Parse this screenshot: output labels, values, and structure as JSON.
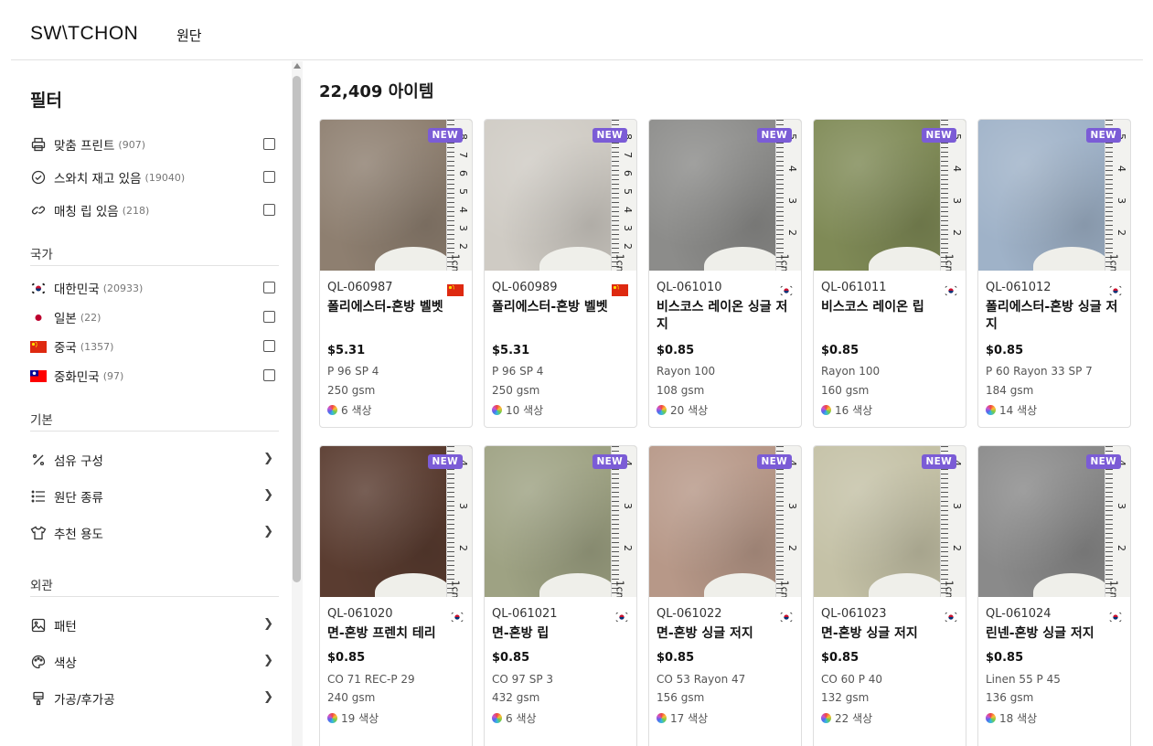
{
  "header": {
    "logo": "SW\\TCHON",
    "nav": "원단"
  },
  "sidebar": {
    "title": "필터",
    "toggles": [
      {
        "icon": "printer-icon",
        "label": "맞춤 프린트",
        "count": "(907)"
      },
      {
        "icon": "check-circle-icon",
        "label": "스와치 재고 있음",
        "count": "(19040)"
      },
      {
        "icon": "link-icon",
        "label": "매칭 립 있음",
        "count": "(218)"
      }
    ],
    "country_section": "국가",
    "countries": [
      {
        "flag": "kr",
        "label": "대한민국",
        "count": "(20933)"
      },
      {
        "flag": "jp",
        "label": "일본",
        "count": "(22)"
      },
      {
        "flag": "cn",
        "label": "중국",
        "count": "(1357)"
      },
      {
        "flag": "tw",
        "label": "중화민국",
        "count": "(97)"
      }
    ],
    "basic_section": "기본",
    "basic_items": [
      {
        "icon": "percent-icon",
        "label": "섬유 구성"
      },
      {
        "icon": "list-icon",
        "label": "원단 종류"
      },
      {
        "icon": "shirt-icon",
        "label": "추천 용도"
      }
    ],
    "appearance_section": "외관",
    "appearance_items": [
      {
        "icon": "image-icon",
        "label": "패턴"
      },
      {
        "icon": "palette-icon",
        "label": "색상"
      },
      {
        "icon": "brush-icon",
        "label": "가공/후가공"
      }
    ]
  },
  "main": {
    "item_count": "22,409 아이템",
    "badge": "NEW",
    "products": [
      {
        "code": "QL-060987",
        "flag": "cn",
        "name": "폴리에스터-혼방 벨벳",
        "price": "$5.31",
        "composition": "P 96 SP 4",
        "gsm": "250 gsm",
        "colors": "6 색상",
        "swatch": "#8e7f70",
        "ruler": [
          "8",
          "7",
          "6",
          "5",
          "4",
          "3",
          "2",
          "1cm"
        ]
      },
      {
        "code": "QL-060989",
        "flag": "cn",
        "name": "폴리에스터-혼방 벨벳",
        "price": "$5.31",
        "composition": "P 96 SP 4",
        "gsm": "250 gsm",
        "colors": "10 색상",
        "swatch": "#cfcbc4",
        "ruler": [
          "8",
          "7",
          "6",
          "5",
          "4",
          "3",
          "2",
          "1cm"
        ]
      },
      {
        "code": "QL-061010",
        "flag": "kr",
        "name": "비스코스 레이온 싱글 저지",
        "price": "$0.85",
        "composition": "Rayon 100",
        "gsm": "108 gsm",
        "colors": "20 색상",
        "swatch": "#8c8c8a",
        "ruler": [
          "5",
          "4",
          "3",
          "2",
          "1cm"
        ]
      },
      {
        "code": "QL-061011",
        "flag": "kr",
        "name": "비스코스 레이온 립",
        "price": "$0.85",
        "composition": "Rayon 100",
        "gsm": "160 gsm",
        "colors": "16 색상",
        "swatch": "#7f8a56",
        "ruler": [
          "5",
          "4",
          "3",
          "2",
          "1cm"
        ]
      },
      {
        "code": "QL-061012",
        "flag": "kr",
        "name": "폴리에스터-혼방 싱글 저지",
        "price": "$0.85",
        "composition": "P 60 Rayon 33 SP 7",
        "gsm": "184 gsm",
        "colors": "14 색상",
        "swatch": "#9fb2c8",
        "ruler": [
          "5",
          "4",
          "3",
          "2",
          "1cm"
        ]
      },
      {
        "code": "QL-061020",
        "flag": "kr",
        "name": "면-혼방 프렌치 테리",
        "price": "$0.85",
        "composition": "CO 71 REC-P 29",
        "gsm": "240 gsm",
        "colors": "19 색상",
        "swatch": "#5a3c30",
        "ruler": [
          "4",
          "3",
          "2",
          "1cm"
        ]
      },
      {
        "code": "QL-061021",
        "flag": "kr",
        "name": "면-혼방 립",
        "price": "$0.85",
        "composition": "CO 97 SP 3",
        "gsm": "432 gsm",
        "colors": "6 색상",
        "swatch": "#9ea283",
        "ruler": [
          "4",
          "3",
          "2",
          "1cm"
        ]
      },
      {
        "code": "QL-061022",
        "flag": "kr",
        "name": "면-혼방 싱글 저지",
        "price": "$0.85",
        "composition": "CO 53 Rayon 47",
        "gsm": "156 gsm",
        "colors": "17 색상",
        "swatch": "#b79888",
        "ruler": [
          "4",
          "3",
          "2",
          "1cm"
        ]
      },
      {
        "code": "QL-061023",
        "flag": "kr",
        "name": "면-혼방 싱글 저지",
        "price": "$0.85",
        "composition": "CO 60 P 40",
        "gsm": "132 gsm",
        "colors": "22 색상",
        "swatch": "#c4c1a6",
        "ruler": [
          "4",
          "3",
          "2",
          "1cm"
        ]
      },
      {
        "code": "QL-061024",
        "flag": "kr",
        "name": "린넨-혼방 싱글 저지",
        "price": "$0.85",
        "composition": "Linen 55 P 45",
        "gsm": "136 gsm",
        "colors": "18 색상",
        "swatch": "#8a8a8a",
        "ruler": [
          "4",
          "3",
          "2",
          "1cm"
        ]
      }
    ]
  }
}
